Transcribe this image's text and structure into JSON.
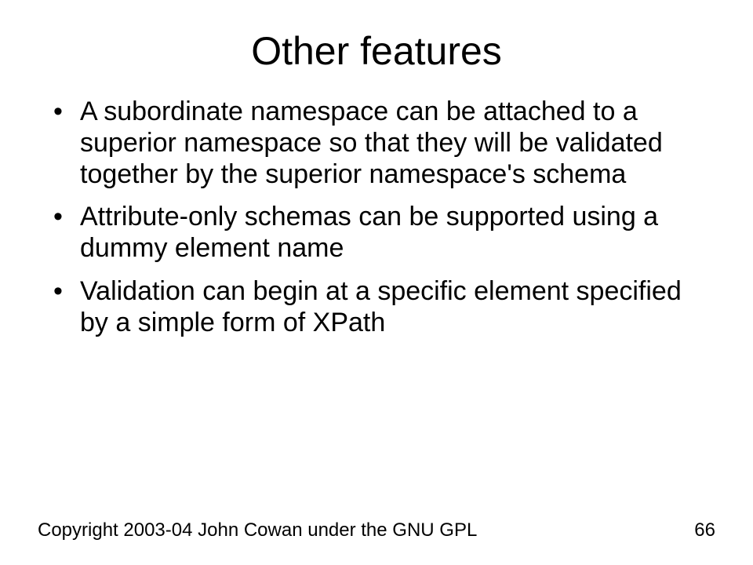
{
  "title": "Other features",
  "bullets": [
    "A subordinate namespace can be attached to a superior namespace so that they will be validated together by the superior namespace's schema",
    "Attribute-only schemas can be supported using a dummy element name",
    "Validation can begin at a specific element specified by a simple form of XPath"
  ],
  "footer": {
    "copyright": "Copyright 2003-04 John Cowan under the GNU GPL",
    "page": "66"
  }
}
